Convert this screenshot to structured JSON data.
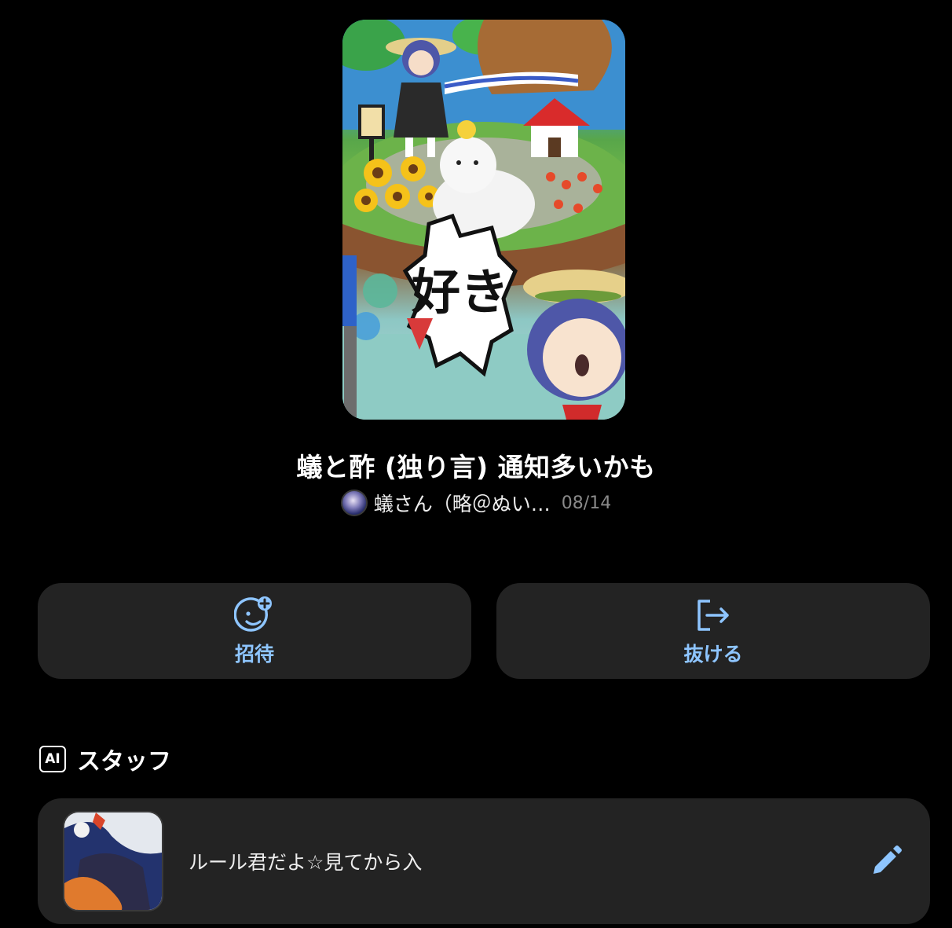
{
  "group": {
    "title": "蟻と酢 (独り言) 通知多いかも",
    "owner_name": "蟻さん（略＠ぬい…",
    "date": "08/14",
    "cover_text": "好き"
  },
  "actions": {
    "invite_label": "招待",
    "leave_label": "抜ける"
  },
  "staff_section": {
    "badge": "AI",
    "title": "スタッフ",
    "items": [
      {
        "name": "ルール君だよ☆見てから入"
      }
    ]
  },
  "colors": {
    "background": "#000000",
    "card": "#232323",
    "accent": "#8ec5ff",
    "date_gray": "#8a8a8a"
  },
  "icons": {
    "invite": "face-plus-icon",
    "leave": "exit-icon",
    "edit": "pencil-icon"
  }
}
